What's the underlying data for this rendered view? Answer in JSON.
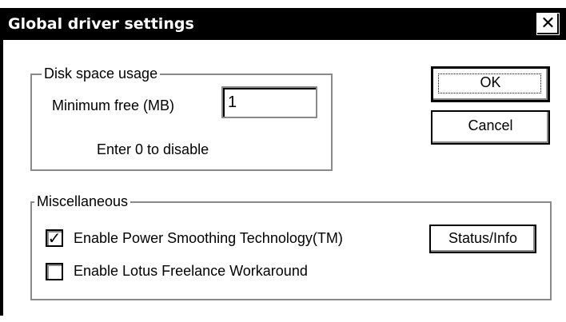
{
  "window": {
    "title": "Global driver settings",
    "close_glyph": "✕"
  },
  "disk_group": {
    "legend": "Disk space usage",
    "min_free_label": "Minimum free (MB)",
    "min_free_value": "1",
    "hint": "Enter 0 to disable"
  },
  "buttons": {
    "ok": "OK",
    "cancel": "Cancel",
    "status_info": "Status/Info"
  },
  "misc_group": {
    "legend": "Miscellaneous",
    "options": [
      {
        "label": "Enable Power Smoothing Technology(TM)",
        "checked": true,
        "mark": "✓"
      },
      {
        "label": "Enable Lotus Freelance Workaround",
        "checked": false,
        "mark": ""
      }
    ]
  },
  "colors": {
    "titlebar": "#000000",
    "background": "#ffffff",
    "groupbox_border": "#8a8a8a"
  },
  "icons": {
    "close": "close-icon",
    "check": "check-icon"
  }
}
